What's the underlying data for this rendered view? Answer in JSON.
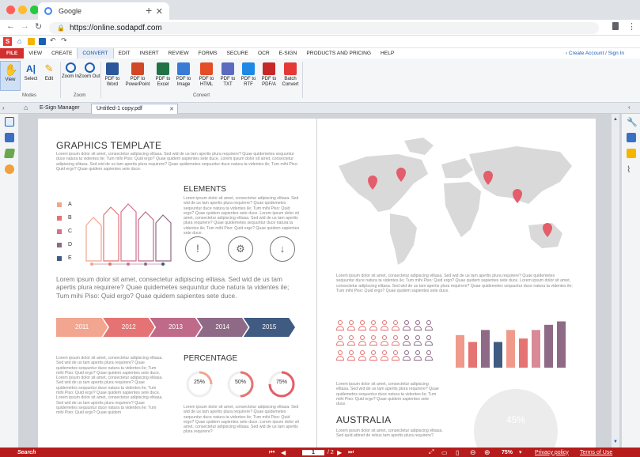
{
  "browser": {
    "tab_title": "Google",
    "url": "https://online.sodapdf.com"
  },
  "app": {
    "logo_letter": "S",
    "menu": [
      "FILE",
      "VIEW",
      "CREATE",
      "CONVERT",
      "EDIT",
      "INSERT",
      "REVIEW",
      "FORMS",
      "SECURE",
      "OCR",
      "E-SIGN",
      "PRODUCTS AND PRICING",
      "HELP"
    ],
    "account_link": "Create Account / Sign In"
  },
  "ribbon": {
    "modes_buttons": [
      {
        "label": "View",
        "icon": "hand-icon"
      },
      {
        "label": "Select",
        "icon": "select-text-icon"
      },
      {
        "label": "Edit",
        "icon": "edit-icon"
      }
    ],
    "zoom_buttons": [
      {
        "label": "Zoom In",
        "icon": "zoom-in-icon"
      },
      {
        "label": "Zoom Out",
        "icon": "zoom-out-icon"
      }
    ],
    "convert_buttons": [
      {
        "label": "PDF to Word",
        "color": "#2b579a"
      },
      {
        "label": "PDF to PowerPoint",
        "color": "#d24726"
      },
      {
        "label": "PDF to Excel",
        "color": "#217346"
      },
      {
        "label": "PDF to Image",
        "color": "#3a7bd5"
      },
      {
        "label": "PDF to HTML",
        "color": "#e44d26"
      },
      {
        "label": "PDF to TXT",
        "color": "#5c6bc0"
      },
      {
        "label": "PDF to RTF",
        "color": "#1e88e5"
      },
      {
        "label": "PDF to PDF/A",
        "color": "#c62828"
      },
      {
        "label": "Batch Convert",
        "color": "#e53935"
      }
    ],
    "group_modes": "Modes",
    "group_zoom": "Zoom",
    "group_convert": "Convert"
  },
  "doc_tabs": {
    "esign": "E-Sign Manager",
    "file": "Untitled-1 copy.pdf"
  },
  "left_page": {
    "title": "GRAPHICS TEMPLATE",
    "intro": "Lorem ipsum dolor sit amet, consectetur adipiscing elitasa. Sed wid de us tam apertis plura requirere? Quae quidemetes sequuntur duce natura ta videntes ile; Tum mihi Piso: Quid ergo? Quae quidem sapientes sete duce. Lorem ipsum dolor sit amet, consectetur adipiscing elitasa. Sed wid de us tam apertis plura requirere? Quae quidemetes sequuntur duce natura ta videntes ile; Tum mihi Piso: Quid ergo? Quae quidem sapientes sete duce.",
    "legend": [
      "A",
      "B",
      "C",
      "D",
      "E"
    ],
    "elements_title": "ELEMENTS",
    "elements_text": "Lorem ipsum dolor sit amet, consectetur adipiscing elitasa. Sed wid de us tam apertis plura requirere? Quae quidemetes sequuntur duce natura ta videntes ile; Tum mihi Piso: Quid ergo? Quae quidem sapientes sete duce. Lorem ipsum dolor sit amet, consectetur adipiscing elitasa. Sed wid de us tam apertis plura requirere? Quae quidemetes sequuntur duce natura ta videntes ile; Tum mihi Piso: Quid ergo? Quae quidem sapientes sete duce.",
    "big_text": "Lorem ipsum dolor sit amet, consectetur adipiscing elitasa. Sed wid de us tam apertis plura requirere? Quae quidemetes sequuntur duce natura ta videntes ile; Tum mihi Piso: Quid ergo? Quae quidem sapientes sete duce.",
    "timeline": [
      "2011",
      "2012",
      "2013",
      "2014",
      "2015"
    ],
    "bottom_text": "Lorem ipsum dolor sit amet, consectetur adipiscing elitasa. Sed wid de us tam apertis plura requirere? Quae quidemetes sequuntur duce natura ta videntes ile; Tum mihi Piso: Quid ergo? Quae quidem sapientes sete duce. Lorem ipsum dolor sit amet, consectetur adipiscing elitasa. Sed wid de us tam apertis plura requirere? Quae quidemetes sequuntur duce natura ta videntes ile; Tum mihi Piso: Quid ergo? Quae quidem sapientes sete duce. Lorem ipsum dolor sit amet, consectetur adipiscing elitasa. Sed wid de us tam apertis plura requirere? Quae quidemetes sequuntur duce natura ta videntes ile; Tum mihi Piso: Quid ergo? Quae quidem",
    "percentage_title": "PERCENTAGE",
    "percentages": [
      {
        "label": "25%",
        "value": 0.25
      },
      {
        "label": "50%",
        "value": 0.5
      },
      {
        "label": "75%",
        "value": 0.75
      }
    ],
    "percentage_text": "Lorem ipsum dolor sit amet, consectetur adipiscing elitasa. Sed wid de us tam apertis plura requirere? Quae quidemetes sequuntur duce natura ta videntes ile; Tum mihi Piso: Quid ergo? Quae quidem sapientes sete duce. Lorem ipsum dolor sit amet, consectetur adipiscing elitasa. Sed wid de us tam apertis plura requirere?"
  },
  "right_page": {
    "map_text": "Lorem ipsum dolor sit amet, consectetur adipiscing elitasa. Sed wid de us tam apertis plura requirere? Quae quidemetes sequuntur duce natura ta videntes ile; Tum mihi Piso: Quid ergo? Quae quidem sapientes sete duce. Lorem ipsum dolor sit amet, consectetur adipiscing elitasa. Sed wid de us tam apertis plura requirere? Quae quidemetes sequuntur duce natura ta videntes ile; Tum mihi Piso: Quid ergo? Quae quidem sapientes sete duce.",
    "people_text": "Lorem ipsum dolor sit amet, consectetur adipiscing elitasa. Sed wid de us tam apertis plura requirere? Quae quidemetes sequuntur duce natura ta videntes ile; Tum mihi Piso: Quid ergo? Quae quidem sapientes sete duce.",
    "australia_title": "AUSTRALIA",
    "australia_text": "Lorem ipsum dolor sit amet, consectetur adipiscing elitasa. Sed quid attinet de rebus tam apertis plura requirere?",
    "australia_pct": "45%"
  },
  "chart_data": {
    "type": "bar",
    "values": [
      38,
      30,
      44,
      30,
      44,
      34,
      44,
      50,
      54
    ],
    "colors": [
      "#ef9a8a",
      "#e57373",
      "#8e6a86",
      "#3f5b82",
      "#ef9a8a",
      "#e57373",
      "#d98a96",
      "#8e6a86",
      "#8e6a86"
    ]
  },
  "status": {
    "search": "Search",
    "page": "1",
    "page_total": "/ 2",
    "zoom": "75%",
    "privacy": "Privacy policy",
    "terms": "Terms of Use"
  }
}
